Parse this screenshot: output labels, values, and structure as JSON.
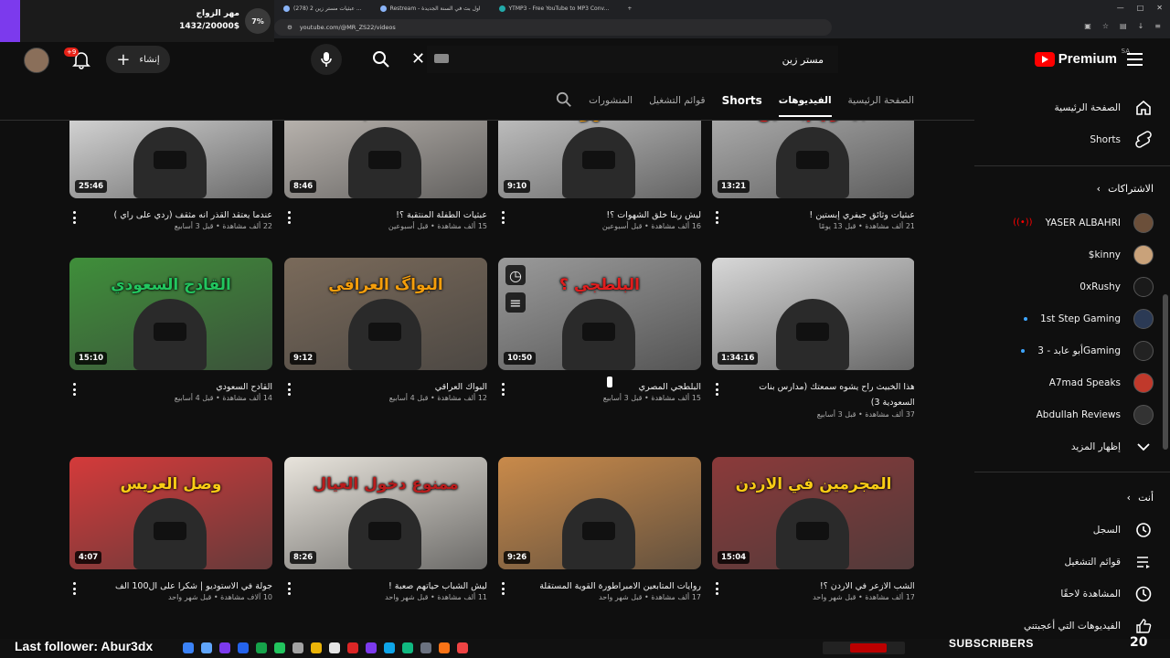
{
  "browser": {
    "tabs": [
      {
        "label": "(278) عبثيات مستر زين 2 ..."
      },
      {
        "label": "Restream - اول بث في السنة الجديدة"
      },
      {
        "label": "YTMP3 - Free YouTube to MP3 Conv..."
      }
    ],
    "new_tab": "+",
    "url": "youtube.com/@MR_ZS22/videos"
  },
  "stream_overlay": {
    "goal_title": "مهر الزواج",
    "goal_amount": "1432/20000$",
    "goal_percent": "7%",
    "goal_progress": 0.07,
    "last_follower": "Last follower: Abur3dx",
    "subscribers_label": "SUBSCRIBERS",
    "subscribers_count": "20"
  },
  "header": {
    "logo_text": "Premium",
    "country": "SA",
    "search_value": "مستر زين",
    "create_label": "إنشاء",
    "notifications": "+9"
  },
  "channel_tabs": [
    {
      "label": "الصفحة الرئيسية",
      "active": false
    },
    {
      "label": "الفيديوهات",
      "active": true
    },
    {
      "label": "Shorts",
      "active": false
    },
    {
      "label": "قوائم التشغيل",
      "active": false
    },
    {
      "label": "المنشورات",
      "active": false
    }
  ],
  "videos": [
    {
      "title": "عبثيات وثائق جيفري إبستين !",
      "views": "21 ألف مشاهدة",
      "age": "قبل 13 يومًا",
      "duration": "13:21",
      "thumb_text": "جيفري إبستين",
      "thumb_color": "#b9b9b9",
      "text_color": "#e11d1d",
      "progress": 0.0
    },
    {
      "title": "ليش ربنا خلق الشهوات ؟!",
      "views": "16 ألف مشاهدة",
      "age": "قبل أسبوعين",
      "duration": "9:10",
      "thumb_text": "-الشهوه-",
      "thumb_color": "#cfcfcf",
      "text_color": "#f59e0b",
      "progress": 0.0
    },
    {
      "title": "عبثيات الطفلة المنتقبة ؟!",
      "views": "15 ألف مشاهدة",
      "age": "قبل أسبوعين",
      "duration": "8:46",
      "thumb_text": "طفله منقبه ؟؟",
      "thumb_color": "#c9c3bd",
      "text_color": "#e11d1d",
      "progress": 0.0
    },
    {
      "title": "عندما يعتقد القذر انه مثقف (ردي على راي )",
      "views": "22 ألف مشاهدة",
      "age": "قبل 3 أسابيع",
      "duration": "25:46",
      "thumb_text": "",
      "thumb_color": "#e8e8e8",
      "text_color": "#000000",
      "progress": 0.0
    },
    {
      "title": "هذا الخبيث راح يشوه سمعتك (مدارس بنات السعودية 3)",
      "views": "37 ألف مشاهدة",
      "age": "قبل 3 أسابيع",
      "duration": "1:34:16",
      "thumb_text": "",
      "thumb_color": "#d8d8d8",
      "text_color": "#ffffff",
      "progress": 0.0
    },
    {
      "title": "البلطجي المصري",
      "views": "15 ألف مشاهدة",
      "age": "قبل 3 أسابيع",
      "duration": "10:50",
      "thumb_text": "البلطجي ؟",
      "thumb_color": "#9a9a9a",
      "text_color": "#e11d1d",
      "progress": 0.0
    },
    {
      "title": "البواك العراقي",
      "views": "12 ألف مشاهدة",
      "age": "قبل 4 أسابيع",
      "duration": "9:12",
      "thumb_text": "البواگ العراقي",
      "thumb_color": "#7a6a5a",
      "text_color": "#f59e0b",
      "progress": 0.0
    },
    {
      "title": "القادح السعودي",
      "views": "14 ألف مشاهدة",
      "age": "قبل 4 أسابيع",
      "duration": "15:10",
      "thumb_text": "القادح السعودي",
      "thumb_color": "#3f8f3a",
      "text_color": "#22c55e",
      "progress": 0.0
    },
    {
      "title": "الشب الازعر في الاردن ؟!",
      "views": "17 ألف مشاهدة",
      "age": "قبل شهر واحد",
      "duration": "15:04",
      "thumb_text": "المجرمين في الاردن",
      "thumb_color": "#8b3a3a",
      "text_color": "#facc15",
      "progress": 0.0
    },
    {
      "title": "روايات المتابعين الامبراطورة القوية المستقلة",
      "views": "17 ألف مشاهدة",
      "age": "قبل شهر واحد",
      "duration": "9:26",
      "thumb_text": "",
      "thumb_color": "#c98a4a",
      "text_color": "#ffffff",
      "progress": 0.0
    },
    {
      "title": "ليش الشباب حياتهم صعبة !",
      "views": "11 ألف مشاهدة",
      "age": "قبل شهر واحد",
      "duration": "8:26",
      "thumb_text": "ممنوع دخول العيال",
      "thumb_color": "#e8e4dc",
      "text_color": "#b91c1c",
      "progress": 0.0
    },
    {
      "title": "جولة في الاستوديو | شكرا على ال100 الف",
      "views": "10 آلاف مشاهدة",
      "age": "قبل شهر واحد",
      "duration": "4:07",
      "thumb_text": "وصل العريس",
      "thumb_color": "#d43a3a",
      "text_color": "#facc15",
      "progress": 0.0
    }
  ],
  "sidebar": {
    "home": "الصفحة الرئيسية",
    "shorts": "Shorts",
    "subscriptions_header": "الاشتراكات",
    "channels": [
      {
        "name": "YASER ALBAHRI",
        "live": true,
        "color": "#6b4f3a"
      },
      {
        "name": "$kinny",
        "live": false,
        "color": "#c9a27a"
      },
      {
        "name": "0xRushy",
        "live": false,
        "color": "#1a1a1a"
      },
      {
        "name": "1st Step Gaming",
        "live": false,
        "dot": true,
        "color": "#2b3a55"
      },
      {
        "name": "أبو عابد - 3Gaming",
        "live": false,
        "dot": true,
        "color": "#222222"
      },
      {
        "name": "A7mad Speaks",
        "live": false,
        "color": "#c0392b"
      },
      {
        "name": "Abdullah Reviews",
        "live": false,
        "color": "#333333"
      }
    ],
    "show_more": "إظهار المزيد",
    "you_header": "أنت",
    "you_items": [
      {
        "label": "السجل",
        "icon": "history-icon"
      },
      {
        "label": "قوائم التشغيل",
        "icon": "playlists-icon"
      },
      {
        "label": "المشاهدة لاحقًا",
        "icon": "watch-later-icon"
      },
      {
        "label": "الفيديوهات التي أعجبتني",
        "icon": "like-icon"
      }
    ]
  }
}
